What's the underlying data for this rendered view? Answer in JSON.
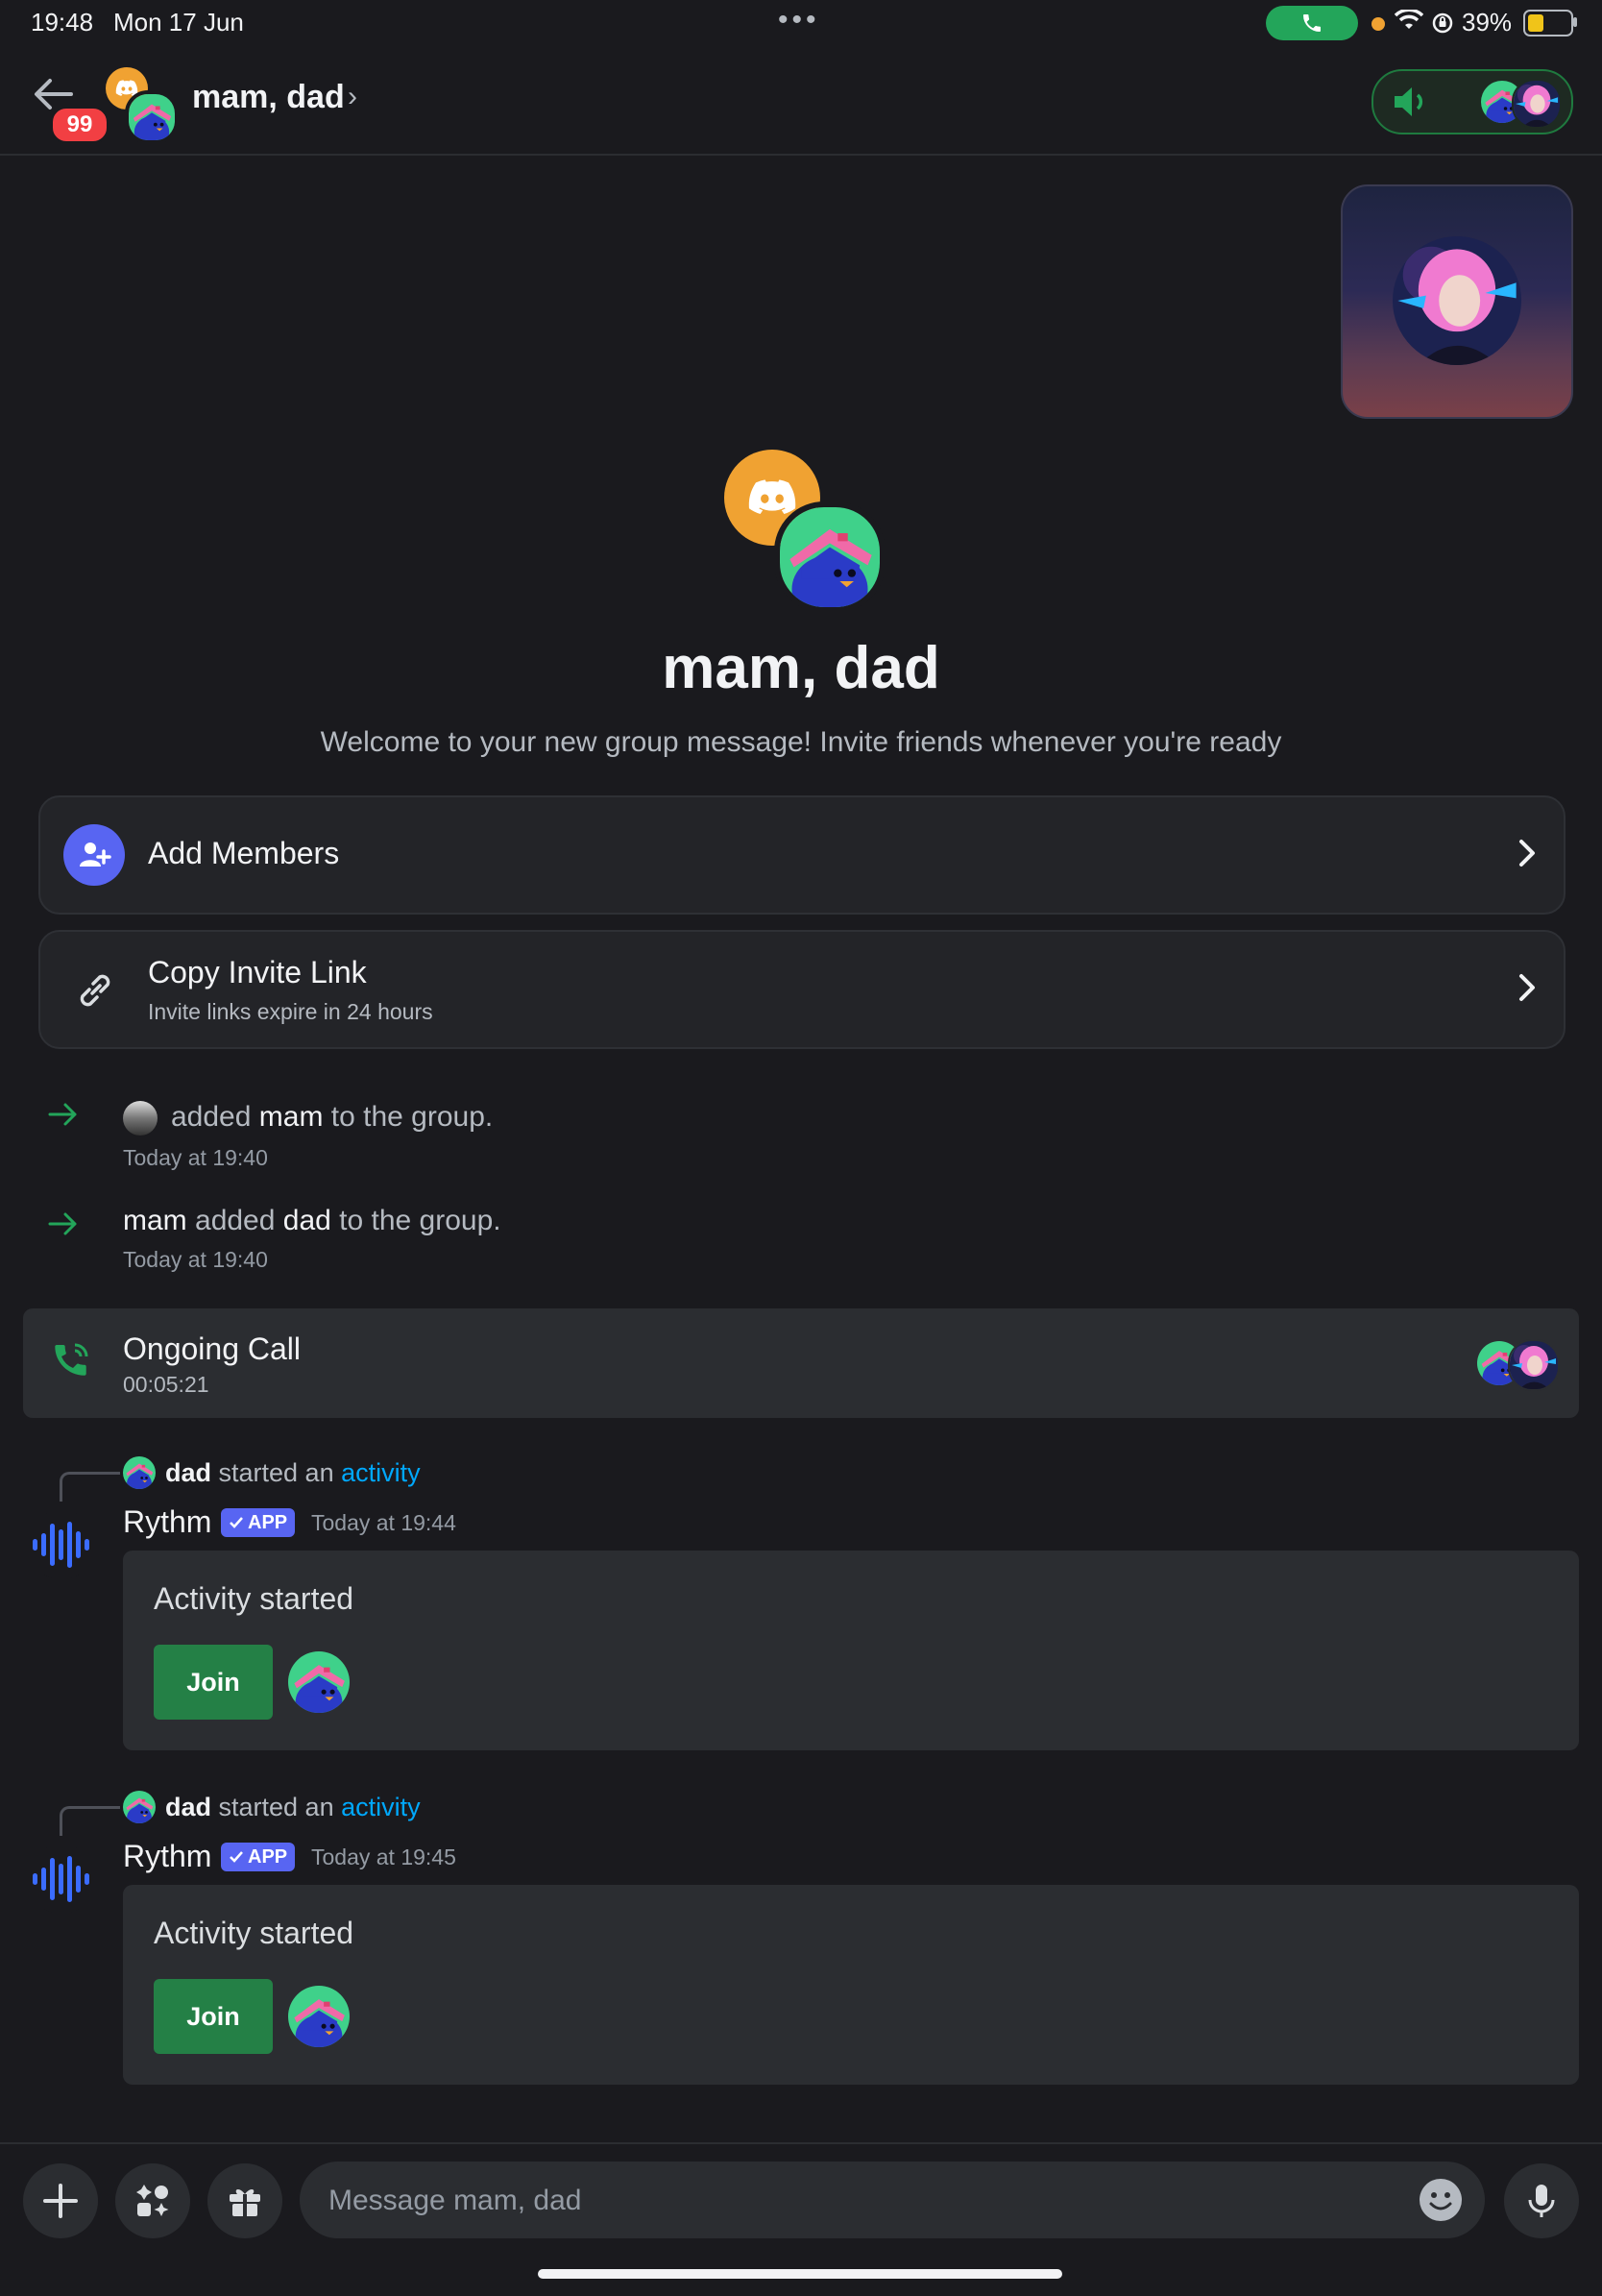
{
  "status_bar": {
    "time": "19:48",
    "date": "Mon 17 Jun",
    "battery": "39%",
    "battery_level": 0.39,
    "dots": "•••"
  },
  "header": {
    "back_badge": "99",
    "title": "mam, dad",
    "chevron": "›"
  },
  "welcome": {
    "title": "mam, dad",
    "subtitle": "Welcome to your new group message! Invite friends whenever you're ready"
  },
  "actions": [
    {
      "label": "Add Members"
    },
    {
      "label": "Copy Invite Link",
      "sublabel": "Invite links expire in 24 hours"
    }
  ],
  "system_messages": [
    {
      "pre": "added ",
      "name": "mam",
      "post": " to the group.",
      "time": "Today at 19:40"
    },
    {
      "actor": "mam",
      "pre": " added ",
      "name": "dad",
      "post": " to the group.",
      "time": "Today at 19:40"
    }
  ],
  "call": {
    "title": "Ongoing Call",
    "duration": "00:05:21"
  },
  "activities": [
    {
      "user": "dad",
      "text": " started an ",
      "link": "activity",
      "bot": "Rythm",
      "tag": "APP",
      "time": "Today at 19:44",
      "embed_title": "Activity started",
      "join_label": "Join"
    },
    {
      "user": "dad",
      "text": " started an ",
      "link": "activity",
      "bot": "Rythm",
      "tag": "APP",
      "time": "Today at 19:45",
      "embed_title": "Activity started",
      "join_label": "Join"
    }
  ],
  "composer": {
    "placeholder": "Message mam, dad"
  },
  "colors": {
    "accent": "#5865f2",
    "online_green": "#23a55a",
    "join_green": "#248046",
    "link_blue": "#00a8fc",
    "badge_red": "#f23f43",
    "avatar_orange": "#f0a232"
  },
  "icons": [
    "back-arrow-icon",
    "phone-icon",
    "wifi-icon",
    "speaker-icon",
    "discord-logo-icon",
    "add-members-icon",
    "link-icon",
    "chevron-right-icon",
    "arrow-right-icon",
    "phone-call-icon",
    "soundwave-icon",
    "check-icon",
    "plus-icon",
    "apps-icon",
    "gift-icon",
    "emoji-icon",
    "mic-icon"
  ]
}
